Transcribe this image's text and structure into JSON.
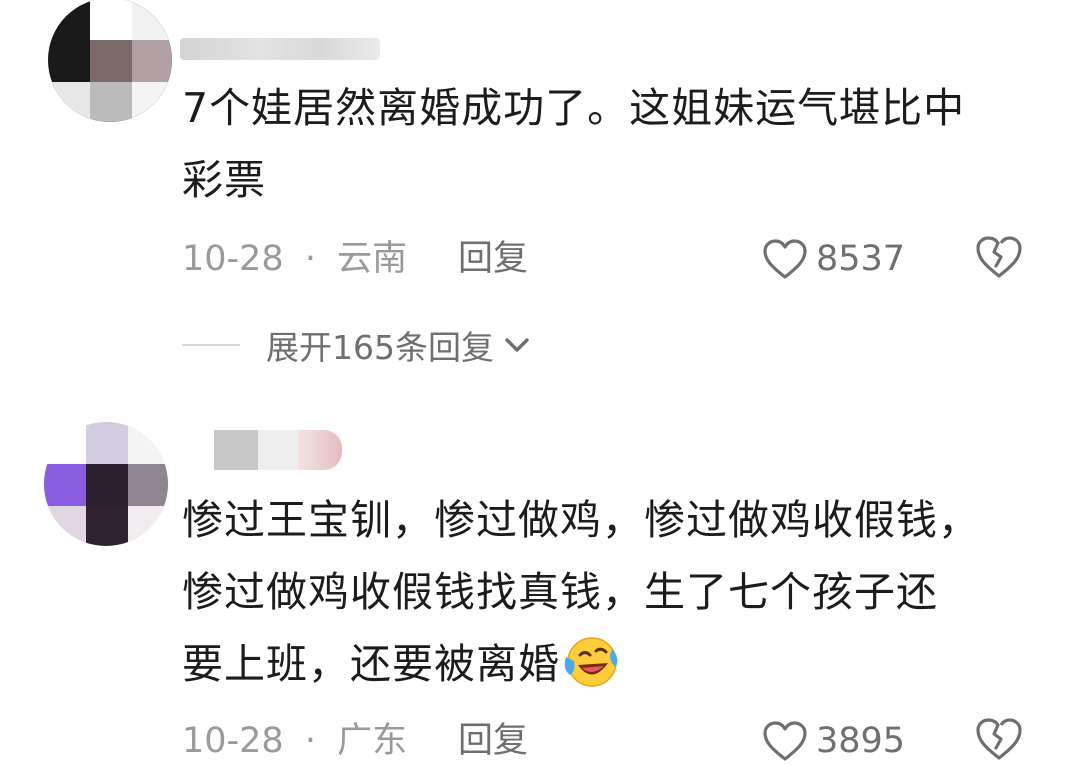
{
  "comments": [
    {
      "username": "",
      "text_lines": [
        "7个娃居然离婚成功了。这姐妹运气堪比中",
        "彩票"
      ],
      "date": "10-28",
      "location": "云南",
      "reply_label": "回复",
      "likes": "8537",
      "expand_label": "展开165条回复"
    },
    {
      "username": "",
      "text_lines": [
        "惨过王宝钏，惨过做鸡，惨过做鸡收假钱，",
        "惨过做鸡收假钱找真钱，生了七个孩子还",
        "要上班，还要被离婚"
      ],
      "emoji": "crying-laughing-emoji",
      "date": "10-28",
      "location": "广东",
      "reply_label": "回复",
      "likes": "3895"
    }
  ],
  "separator": "·",
  "colors": {
    "text": "#1c1c1c",
    "meta": "#9a9a9a",
    "action": "#6f6f6f",
    "background": "#ffffff"
  }
}
